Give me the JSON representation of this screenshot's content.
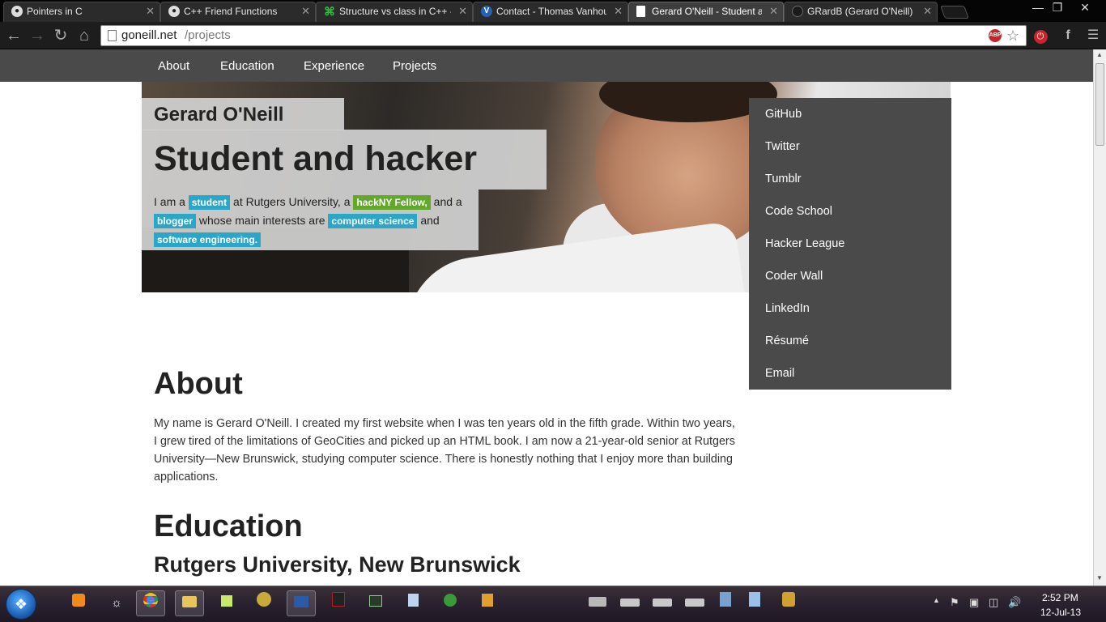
{
  "browser": {
    "tabs": [
      {
        "label": "Pointers in C",
        "icon": "github-octocat-icon"
      },
      {
        "label": "C++ Friend Functions",
        "icon": "github-octocat-icon"
      },
      {
        "label": "Structure vs class in C++ -",
        "icon": "stackoverflow-icon"
      },
      {
        "label": "Contact - Thomas Vanhou",
        "icon": "v-logo-icon"
      },
      {
        "label": "Gerard O'Neill - Student a",
        "icon": "page-icon"
      },
      {
        "label": "GRardB (Gerard O'Neill) · G",
        "icon": "github-octocat-icon"
      }
    ],
    "url_host": "goneill.net",
    "url_path": "/projects",
    "abp_label": "ABP"
  },
  "site": {
    "nav": [
      "About",
      "Education",
      "Experience",
      "Projects"
    ],
    "name": "Gerard O'Neill",
    "tagline": "Student and hacker",
    "intro": {
      "t1": "I am a ",
      "tag1": "student",
      "t2": " at Rutgers University, a ",
      "tag2": "hackNY Fellow,",
      "t3": " and a ",
      "tag3": "blogger",
      "t4": " whose main interests are ",
      "tag4": "computer science",
      "t5": " and ",
      "tag5": "software engineering."
    },
    "social": [
      "GitHub",
      "Twitter",
      "Tumblr",
      "Code School",
      "Hacker League",
      "Coder Wall",
      "LinkedIn",
      "Résumé",
      "Email"
    ],
    "about_heading": "About",
    "about_text": "My name is Gerard O'Neill. I created my first website when I was ten years old in the fifth grade. Within two years, I grew tired of the limitations of GeoCities and picked up an HTML book. I am now a 21-year-old senior at Rutgers University—New Brunswick, studying computer science. There is honestly nothing that I enjoy more than building applications.",
    "education_heading": "Education",
    "school": "Rutgers University, New Brunswick"
  },
  "taskbar": {
    "time": "2:52 PM",
    "date": "12-Jul-13"
  },
  "colors": {
    "nav_bg": "#4a4a4a",
    "tag_blue": "#2aa6c9",
    "tag_green": "#62a82b"
  }
}
